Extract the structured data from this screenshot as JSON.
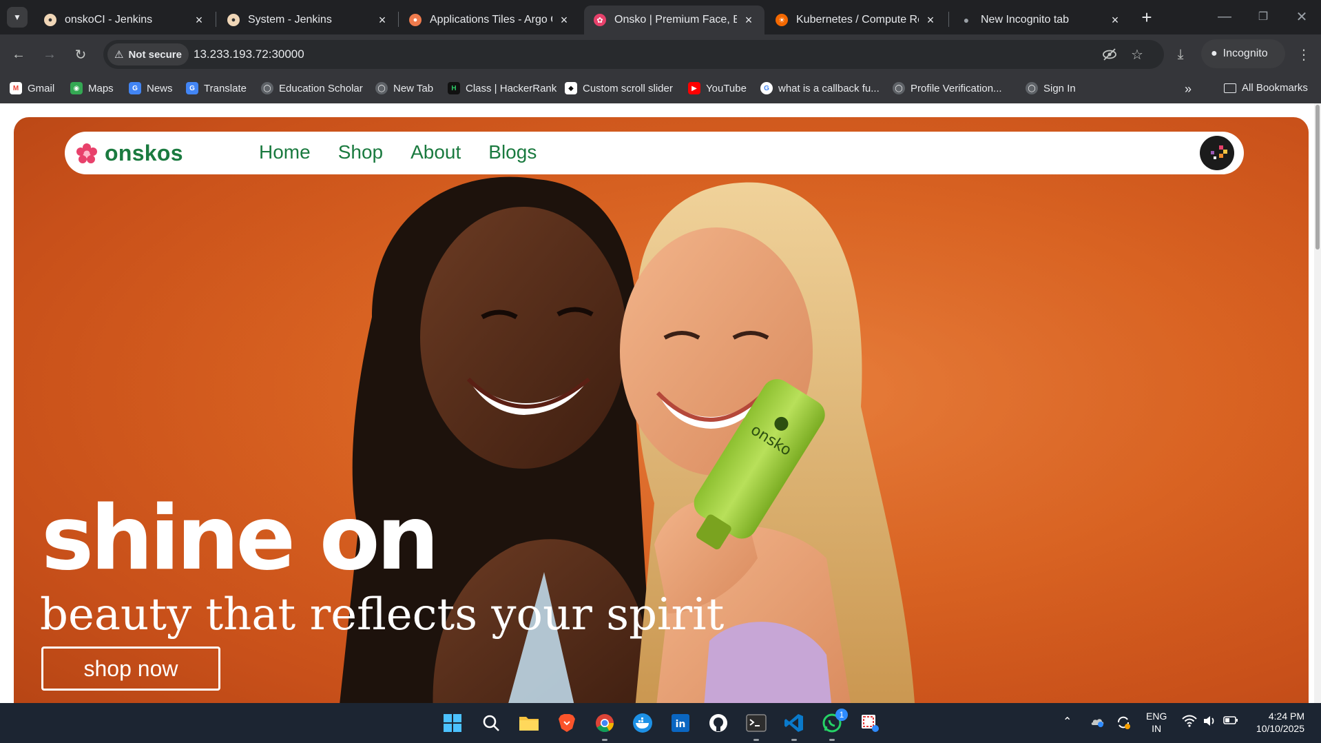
{
  "tabs": [
    {
      "title": "onskoCI - Jenkins",
      "favicon": "jenkins-icon",
      "color": "#d33833"
    },
    {
      "title": "System - Jenkins",
      "favicon": "jenkins-icon",
      "color": "#d33833"
    },
    {
      "title": "Applications Tiles - Argo C",
      "favicon": "argo-icon",
      "color": "#ef7b4d"
    },
    {
      "title": "Onsko | Premium Face, Boc",
      "favicon": "onsko-flower-icon",
      "color": "#e8416b"
    },
    {
      "title": "Kubernetes / Compute Res",
      "favicon": "grafana-icon",
      "color": "#f46800"
    },
    {
      "title": "New Incognito tab",
      "favicon": "incognito-icon",
      "color": "#9aa0a6"
    }
  ],
  "toolbar": {
    "security_label": "Not secure",
    "url": "13.233.193.72:30000",
    "incognito_label": "Incognito"
  },
  "bookmarks": [
    {
      "label": "Gmail",
      "icon": "gmail-icon",
      "color": "#ea4335"
    },
    {
      "label": "Maps",
      "icon": "maps-icon",
      "color": "#34a853"
    },
    {
      "label": "News",
      "icon": "news-icon",
      "color": "#4285f4"
    },
    {
      "label": "Translate",
      "icon": "translate-icon",
      "color": "#4285f4"
    },
    {
      "label": "Education Scholar",
      "icon": "globe-icon",
      "color": "#5f6368"
    },
    {
      "label": "New Tab",
      "icon": "globe-icon",
      "color": "#5f6368"
    },
    {
      "label": "Class | HackerRank",
      "icon": "hackerrank-icon",
      "color": "#111111"
    },
    {
      "label": "Custom scroll slider",
      "icon": "codepen-icon",
      "color": "#444444"
    },
    {
      "label": "YouTube",
      "icon": "youtube-icon",
      "color": "#ff0000"
    },
    {
      "label": "what is a callback fu...",
      "icon": "google-icon",
      "color": "#4285f4"
    },
    {
      "label": "Profile Verification...",
      "icon": "globe-icon",
      "color": "#5f6368"
    },
    {
      "label": "Sign In",
      "icon": "globe-icon",
      "color": "#5f6368"
    }
  ],
  "all_bookmarks_label": "All Bookmarks",
  "site": {
    "brand": "onskos",
    "brand_color": "#1a7a3f",
    "nav": [
      "Home",
      "Shop",
      "About",
      "Blogs"
    ],
    "hero_bg": "#d9611f",
    "headline": "shine on",
    "subheadline": "beauty that reflects your spirit",
    "cta": "shop now",
    "product_label": "onsko"
  },
  "taskbar": {
    "apps": [
      "windows-start-icon",
      "search-icon",
      "file-explorer-icon",
      "brave-icon",
      "chrome-icon",
      "docker-icon",
      "linkedin-icon",
      "github-icon",
      "terminal-icon",
      "vscode-icon",
      "whatsapp-icon",
      "snipping-tool-icon"
    ],
    "whatsapp_badge": "1",
    "lang_line1": "ENG",
    "lang_line2": "IN",
    "time": "4:24 PM",
    "date": "10/10/2025"
  }
}
